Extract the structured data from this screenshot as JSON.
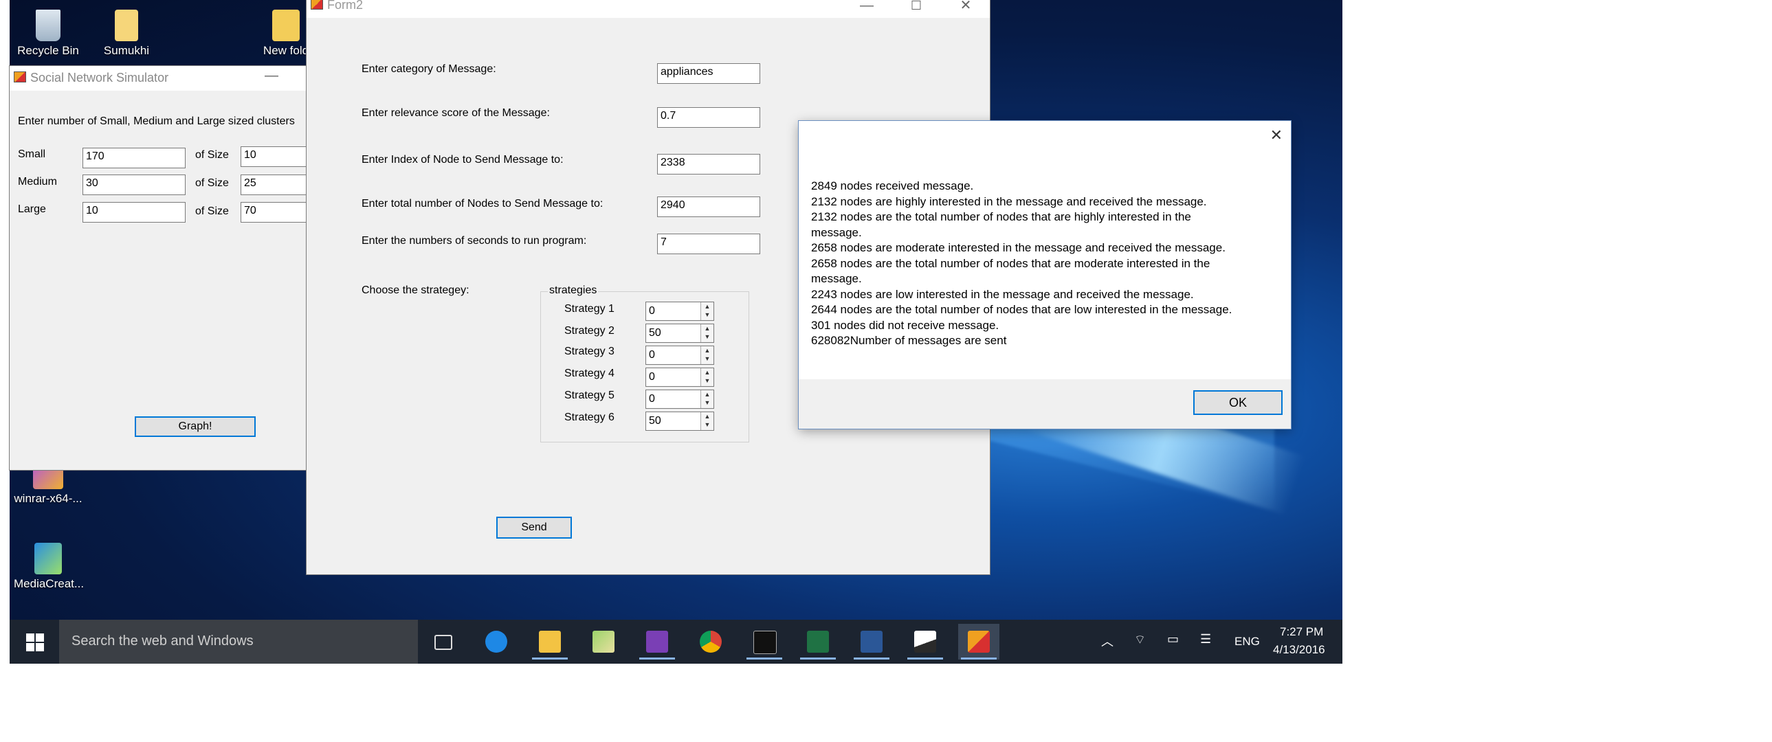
{
  "desktop": {
    "icons": [
      {
        "label": "Recycle Bin"
      },
      {
        "label": "Sumukhi"
      },
      {
        "label": "New fold"
      },
      {
        "label": "winrar-x64-..."
      },
      {
        "label": "MediaCreat..."
      }
    ]
  },
  "sim_window": {
    "title": "Social Network Simulator",
    "prompt": "Enter number of Small, Medium and Large sized clusters",
    "rows": [
      {
        "label": "Small",
        "count": "170",
        "size_label": "of Size",
        "size": "10"
      },
      {
        "label": "Medium",
        "count": "30",
        "size_label": "of Size",
        "size": "25"
      },
      {
        "label": "Large",
        "count": "10",
        "size_label": "of Size",
        "size": "70"
      }
    ],
    "graph_button": "Graph!"
  },
  "form2": {
    "title": "Form2",
    "fields": [
      {
        "label": "Enter category of Message:",
        "value": "appliances"
      },
      {
        "label": "Enter relevance score of the Message:",
        "value": "0.7"
      },
      {
        "label": "Enter Index of Node to Send Message to:",
        "value": "2338"
      },
      {
        "label": "Enter total number of Nodes to Send Message to:",
        "value": "2940"
      },
      {
        "label": "Enter the numbers of seconds to run program:",
        "value": "7"
      }
    ],
    "strategy_label": "Choose the strategey:",
    "group_title": "strategies",
    "strategies": [
      {
        "label": "Strategy 1",
        "value": "0"
      },
      {
        "label": "Strategy 2",
        "value": "50"
      },
      {
        "label": "Strategy 3",
        "value": "0"
      },
      {
        "label": "Strategy 4",
        "value": "0"
      },
      {
        "label": "Strategy 5",
        "value": "0"
      },
      {
        "label": "Strategy 6",
        "value": "50"
      }
    ],
    "send_button": "Send"
  },
  "message_box": {
    "lines": [
      "2849 nodes received message.",
      "2132 nodes are highly interested in the message and received the message.",
      "2132 nodes are the total number of nodes that are highly interested in the",
      "message.",
      "2658 nodes are moderate interested in the message and received the message.",
      "2658 nodes are the total number of nodes that are moderate interested in the",
      "message.",
      "2243 nodes are low interested in the message and received the message.",
      "2644 nodes are the total number of nodes that are low interested in the message.",
      "301 nodes did not receive message.",
      "628082Number of messages are sent"
    ],
    "ok_button": "OK",
    "close_glyph": "✕"
  },
  "taskbar": {
    "search_placeholder": "Search the web and Windows",
    "language": "ENG",
    "time": "7:27 PM",
    "date": "4/13/2016",
    "apps": [
      "task-view-icon",
      "edge-icon",
      "file-explorer-icon",
      "notepad-icon",
      "visual-studio-icon",
      "chrome-icon",
      "terminal-icon",
      "excel-icon",
      "word-icon",
      "photos-icon",
      "simulator-app-icon"
    ]
  },
  "colors": {
    "accent": "#0078d7",
    "window_bg": "#f0f0f0",
    "taskbar": "#1c2430"
  }
}
